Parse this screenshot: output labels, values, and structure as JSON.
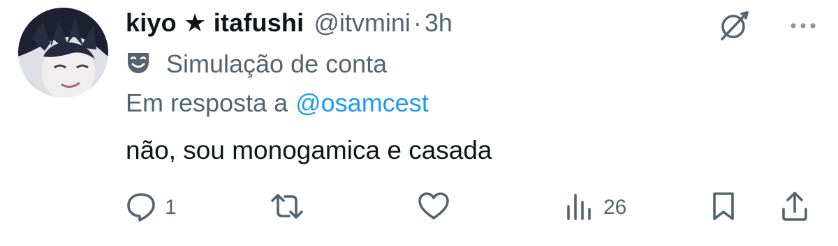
{
  "tweet": {
    "author": {
      "display_name": "kiyo ★ itafushi",
      "handle": "@itvmini",
      "separator": "·",
      "time": "3h"
    },
    "account_label": "Simulação de conta",
    "reply_to": {
      "prefix": "Em resposta a",
      "mention": "@osamcest"
    },
    "text": "não, sou monogamica e casada",
    "actions": {
      "replies": "1",
      "retweets": "",
      "likes": "",
      "views": "26"
    }
  },
  "icons": {
    "avatar": "anime-avatar",
    "grok": "grok-icon",
    "more": "more-icon",
    "label": "theater-mask-icon",
    "reply": "reply-icon",
    "retweet": "retweet-icon",
    "like": "heart-icon",
    "views": "views-icon",
    "bookmark": "bookmark-icon",
    "share": "share-icon"
  },
  "colors": {
    "text_primary": "#0f1419",
    "text_secondary": "#536471",
    "link": "#1d9bf0"
  }
}
